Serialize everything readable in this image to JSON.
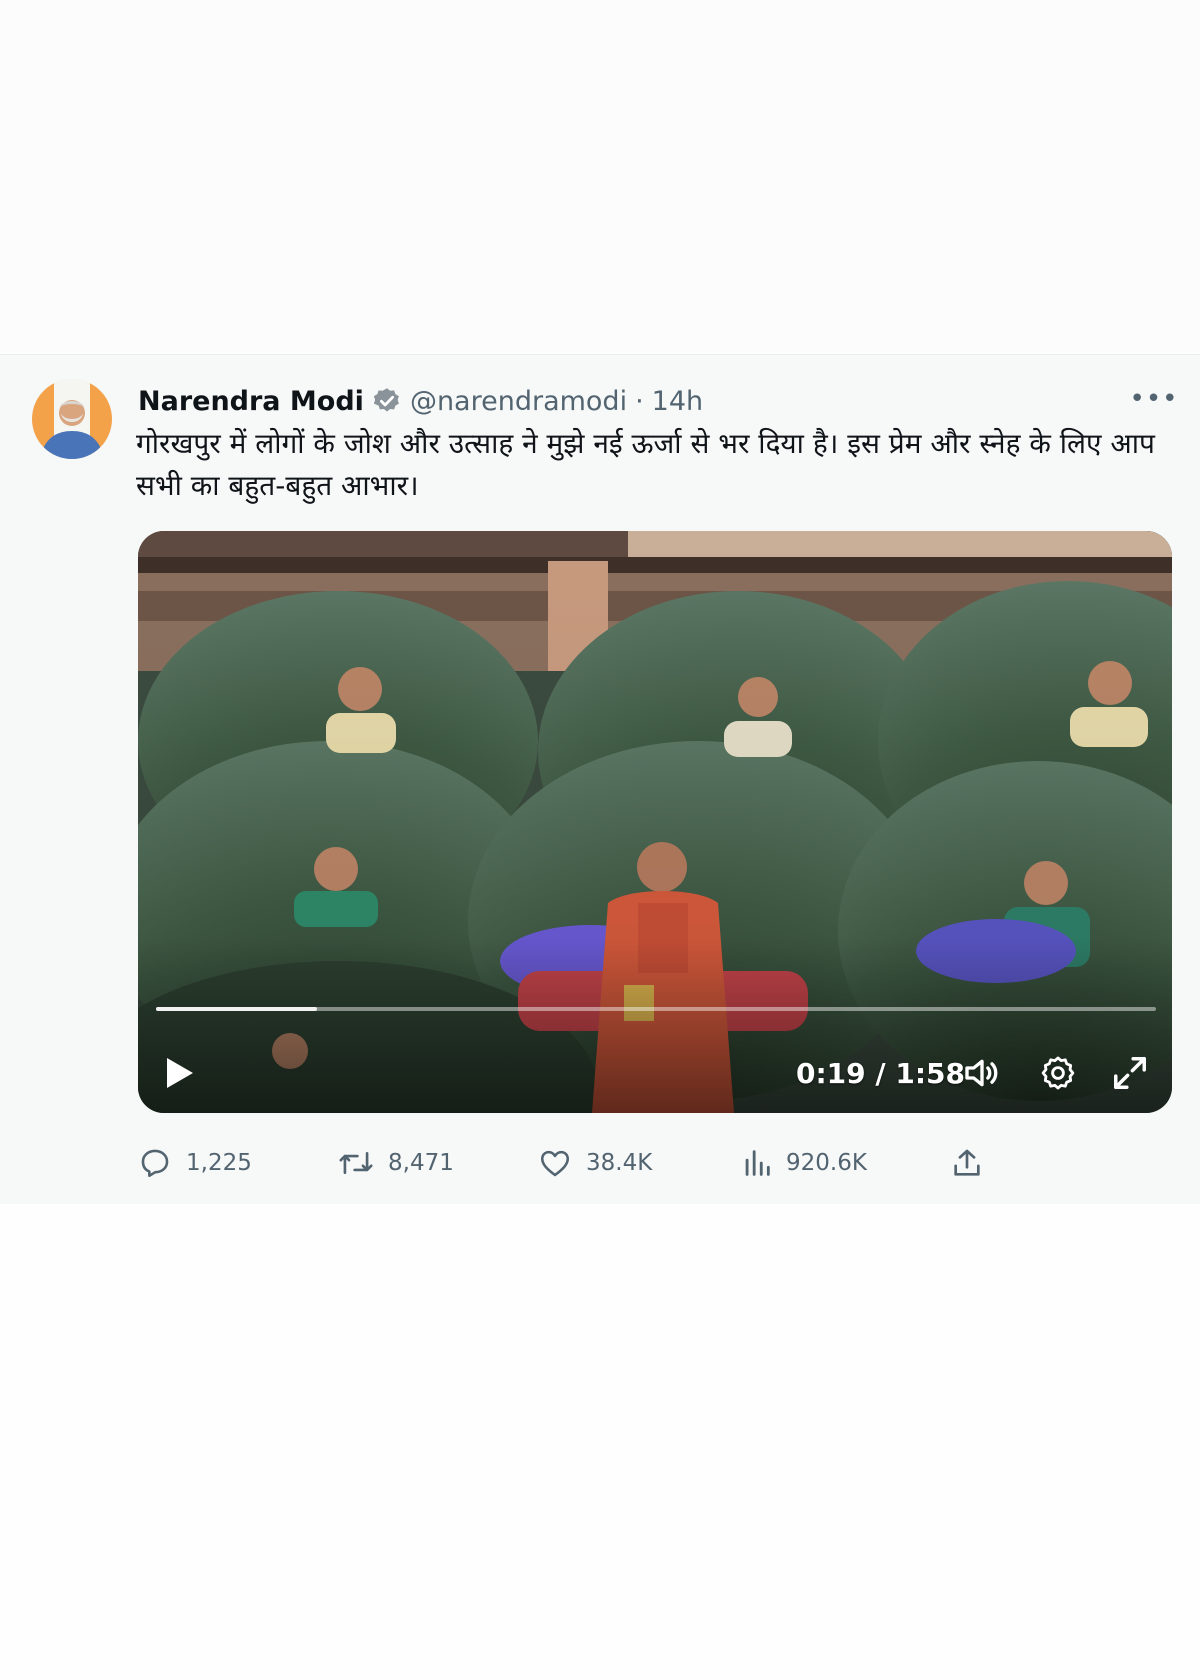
{
  "tweet": {
    "display_name": "Narendra Modi",
    "handle": "@narendramodi",
    "separator": "·",
    "time": "14h",
    "text": "गोरखपुर में लोगों के जोश और उत्साह ने मुझे नई ऊर्जा से भर दिया है। इस प्रेम और स्नेह के लिए आप सभी का बहुत-बहुत आभार।",
    "verified": true
  },
  "video": {
    "current_time": "0:19",
    "duration": "1:58",
    "time_display": "0:19 / 1:58",
    "progress": 0.161
  },
  "actions": {
    "replies": "1,225",
    "retweets": "8,471",
    "likes": "38.4K",
    "views": "920.6K"
  },
  "colors": {
    "verified": "#8a9399",
    "muted_text": "#536471",
    "card_bg": "#f7f8f8"
  },
  "icons": [
    "verified-icon",
    "more-icon",
    "play-icon",
    "volume-icon",
    "settings-icon",
    "fullscreen-icon",
    "reply-icon",
    "retweet-icon",
    "like-icon",
    "views-icon",
    "share-icon"
  ]
}
